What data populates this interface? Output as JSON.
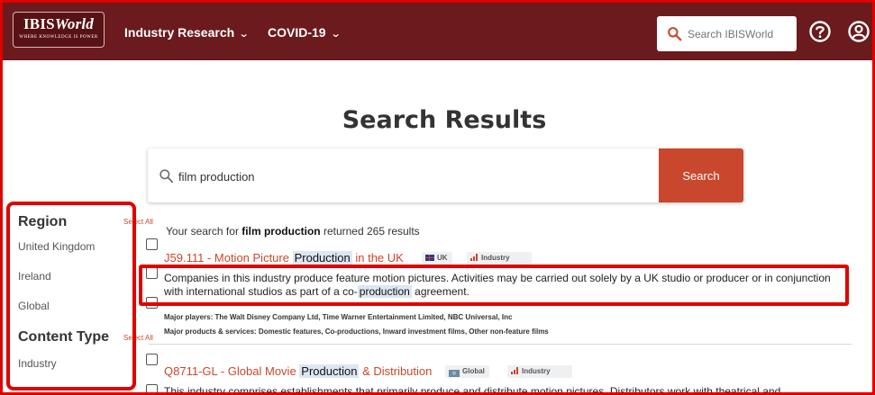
{
  "logo": {
    "main": "IBISWorld",
    "main_prefix": "IBIS",
    "main_suffix": "World",
    "tagline": "WHERE KNOWLEDGE IS POWER"
  },
  "nav": {
    "items": [
      {
        "label": "Industry Research"
      },
      {
        "label": "COVID-19"
      }
    ],
    "search_placeholder": "Search IBISWorld"
  },
  "page": {
    "title": "Search Results"
  },
  "main_search": {
    "value": "film production",
    "button_label": "Search"
  },
  "sidebar": {
    "region_heading": "Region",
    "select_all_label": "Select All",
    "regions": [
      "United Kingdom",
      "Ireland",
      "Global"
    ],
    "content_type_heading": "Content Type",
    "content_types": [
      "Industry"
    ]
  },
  "results_summary": {
    "prefix": "Your search for ",
    "query": "film production",
    "suffix": " returned 265 results"
  },
  "results": [
    {
      "title_parts": [
        "J59.111 - Motion Picture ",
        "Production",
        " in the UK"
      ],
      "region_badge": "UK",
      "type_badge": "Industry",
      "description_parts": [
        "Companies in this industry produce feature motion pictures. Activities may be carried out solely by a UK studio or producer or in conjunction with international studios as part of a co-",
        "production",
        " agreement."
      ],
      "major_players": "Major players: The Walt Disney Company Ltd, Time Warner Entertainment Limited, NBC Universal, Inc",
      "major_products": "Major products & services: Domestic features, Co-productions, Inward investment films, Other non-feature films"
    },
    {
      "title_parts": [
        "Q8711-GL - Global Movie ",
        "Production",
        " & Distribution"
      ],
      "region_badge": "Global",
      "type_badge": "Industry",
      "description": "This industry comprises establishments that primarily produce and distribute motion pictures. Distributors work with theatrical and"
    }
  ],
  "colors": {
    "header": "#6b1a1d",
    "accent": "#c9472c",
    "annotation": "#e00000",
    "highlight": "#dde6f2"
  },
  "icons": {
    "nav_chevron": "chevron-down-icon",
    "search": "search-icon",
    "help": "help-circle-icon",
    "account": "account-icon",
    "uk_flag": "uk-flag-icon",
    "globe": "globe-icon",
    "industry": "bar-chart-icon"
  }
}
